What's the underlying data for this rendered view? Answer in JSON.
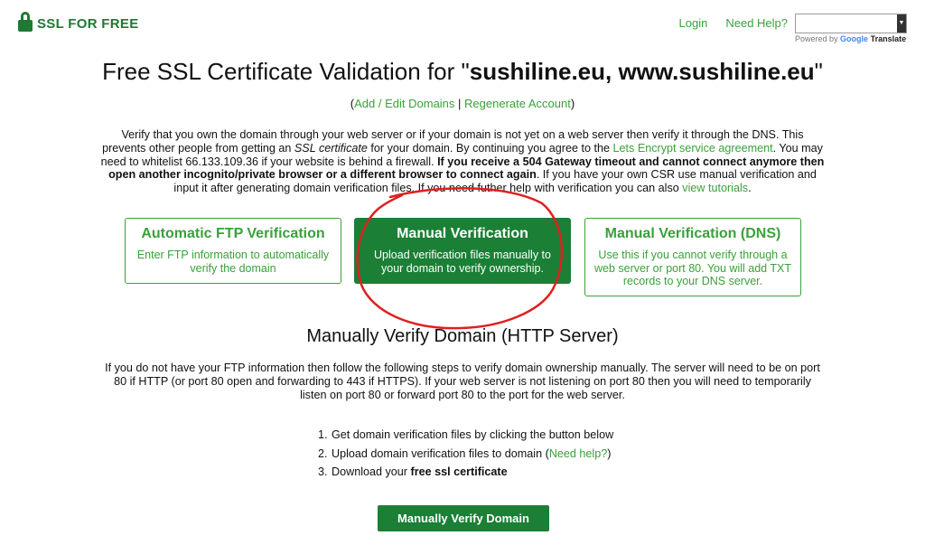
{
  "brand": {
    "logo_text": "SSL FOR FREE",
    "color": "#1e7a32"
  },
  "nav": {
    "login": "Login",
    "need_help": "Need Help?"
  },
  "translate": {
    "powered_by": "Powered by",
    "google": "Google",
    "translate": "Translate"
  },
  "header": {
    "title_prefix": "Free SSL Certificate Validation for \"",
    "domains": "sushiline.eu, www.sushiline.eu",
    "title_suffix": "\""
  },
  "links": {
    "add_edit": "Add / Edit Domains",
    "separator": " | ",
    "regenerate": "Regenerate Account"
  },
  "intro": {
    "t1": "Verify that you own the domain through your web server or if your domain is not yet on a web server then verify it through the DNS. This prevents other people from getting an ",
    "ssl_em": "SSL certificate",
    "t2": " for your domain. By continuing you agree to the ",
    "le_link": "Lets Encrypt service agreement",
    "t3": ". You may need to whitelist 66.133.109.36 if your website is behind a firewall. ",
    "bold": "If you receive a 504 Gateway timeout and cannot connect anymore then open another incognito/private browser or a different browser to connect again",
    "t4": ". If you have your own CSR use manual verification and input it after generating domain verification files. If you need futher help with verification you can also ",
    "tutorials": "view tutorials",
    "t5": "."
  },
  "cards": [
    {
      "title": "Automatic FTP Verification",
      "desc": "Enter FTP information to automatically verify the domain"
    },
    {
      "title": "Manual Verification",
      "desc": "Upload verification files manually to your domain to verify ownership."
    },
    {
      "title": "Manual Verification (DNS)",
      "desc": "Use this if you cannot verify through a web server or port 80. You will add TXT records to your DNS server."
    }
  ],
  "section": {
    "title": "Manually Verify Domain (HTTP Server)",
    "explain": "If you do not have your FTP information then follow the following steps to verify domain ownership manually. The server will need to be on port 80 if HTTP (or port 80 open and forwarding to 443 if HTTPS). If your web server is not listening on port 80 then you will need to temporarily listen on port 80 or forward port 80 to the port for the web server."
  },
  "steps": {
    "s1_num": "1.",
    "s1": "Get domain verification files by clicking the button below",
    "s2_num": "2.",
    "s2": "Upload domain verification files to domain (",
    "s2_link": "Need help?",
    "s2_end": ")",
    "s3_num": "3.",
    "s3": "Download your ",
    "s3_bold": "free ssl certificate"
  },
  "button": {
    "label": "Manually Verify Domain"
  },
  "colors": {
    "accent": "#3aa13a",
    "active": "#1b7f35",
    "annotation": "#e02020"
  }
}
